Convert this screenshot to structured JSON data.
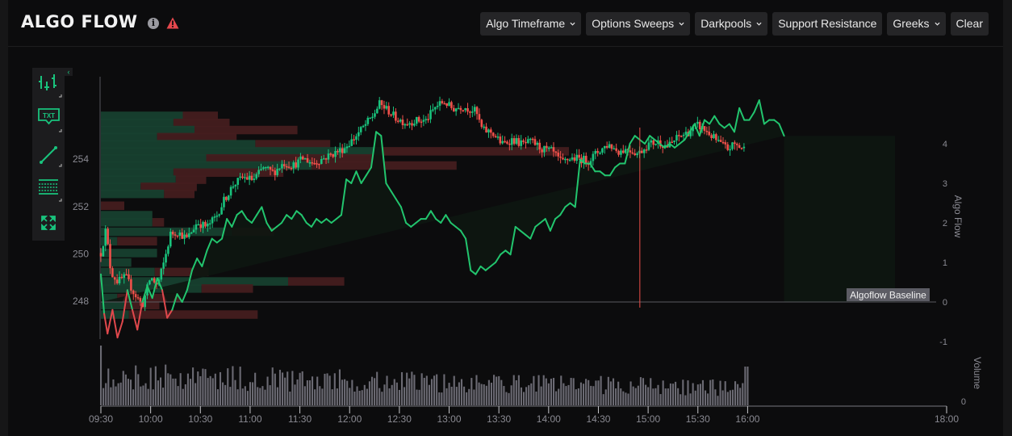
{
  "header": {
    "title": "ALGO FLOW",
    "info_icon": "info-icon",
    "warning_icon": "warning-triangle-icon",
    "warning_color": "#e5484d"
  },
  "toolbar": {
    "buttons": [
      {
        "label": "Algo Timeframe",
        "dropdown": true
      },
      {
        "label": "Options Sweeps",
        "dropdown": true
      },
      {
        "label": "Darkpools",
        "dropdown": true
      },
      {
        "label": "Support Resistance",
        "dropdown": false
      },
      {
        "label": "Greeks",
        "dropdown": true
      },
      {
        "label": "Clear",
        "dropdown": false
      }
    ]
  },
  "drawing_tools": [
    {
      "name": "candlestick-tool",
      "icon": "candles-icon"
    },
    {
      "name": "text-tool",
      "icon": "txt-icon",
      "label": "TXT"
    },
    {
      "name": "trendline-tool",
      "icon": "line-icon"
    },
    {
      "name": "levels-tool",
      "icon": "grid-lines-icon"
    },
    {
      "name": "fullscreen-tool",
      "icon": "expand-icon"
    }
  ],
  "colors": {
    "up": "#19c37d",
    "down": "#f0504a",
    "profile_buy": "#17402f",
    "profile_sell": "#441d1f",
    "algo_line_pos": "#22c56e",
    "algo_line_neg": "#e0484c",
    "algo_fill": "#0d1611",
    "volume": "#6b6a73",
    "axis_text": "#8a8a92",
    "accent": "#19c37d"
  },
  "chart_data": {
    "type": "candlestick+line+volume",
    "title": "ALGO FLOW",
    "x_ticks": [
      "09:30",
      "10:00",
      "10:30",
      "11:00",
      "11:30",
      "12:00",
      "12:30",
      "13:00",
      "13:30",
      "14:00",
      "14:30",
      "15:00",
      "15:30",
      "16:00",
      "18:00"
    ],
    "x_range_minutes": [
      570,
      1080
    ],
    "price_axis": {
      "ticks": [
        248,
        250,
        252,
        254
      ],
      "range": [
        246.5,
        256.5
      ]
    },
    "algo_axis": {
      "label": "Algo Flow",
      "ticks": [
        -1,
        0,
        1,
        2,
        3,
        4
      ],
      "range": [
        -1.2,
        5.3
      ]
    },
    "volume_axis": {
      "label": "Volume",
      "ticks": [
        0
      ]
    },
    "baseline_label": "Algoflow Baseline",
    "marker_time": "14:55",
    "price_path": [
      [
        570,
        250.0
      ],
      [
        573,
        251.0
      ],
      [
        576,
        249.2
      ],
      [
        580,
        248.8
      ],
      [
        585,
        249.0
      ],
      [
        590,
        248.3
      ],
      [
        595,
        247.8
      ],
      [
        600,
        249.0
      ],
      [
        604,
        248.6
      ],
      [
        608,
        249.6
      ],
      [
        612,
        250.8
      ],
      [
        616,
        250.9
      ],
      [
        622,
        250.6
      ],
      [
        628,
        251.3
      ],
      [
        634,
        251.1
      ],
      [
        640,
        251.6
      ],
      [
        644,
        252.2
      ],
      [
        650,
        252.9
      ],
      [
        656,
        253.2
      ],
      [
        662,
        253.1
      ],
      [
        668,
        253.6
      ],
      [
        674,
        253.4
      ],
      [
        680,
        253.8
      ],
      [
        686,
        253.7
      ],
      [
        692,
        254.0
      ],
      [
        698,
        253.8
      ],
      [
        704,
        254.0
      ],
      [
        710,
        254.2
      ],
      [
        716,
        254.4
      ],
      [
        722,
        254.8
      ],
      [
        728,
        255.3
      ],
      [
        734,
        255.8
      ],
      [
        738,
        256.3
      ],
      [
        742,
        256.1
      ],
      [
        748,
        255.7
      ],
      [
        754,
        255.5
      ],
      [
        760,
        255.6
      ],
      [
        766,
        255.6
      ],
      [
        772,
        256.2
      ],
      [
        777,
        256.4
      ],
      [
        782,
        256.1
      ],
      [
        788,
        256.2
      ],
      [
        796,
        256.0
      ],
      [
        800,
        255.2
      ],
      [
        806,
        255.1
      ],
      [
        812,
        254.6
      ],
      [
        818,
        254.8
      ],
      [
        824,
        254.6
      ],
      [
        830,
        254.7
      ],
      [
        836,
        254.4
      ],
      [
        842,
        254.3
      ],
      [
        848,
        253.8
      ],
      [
        852,
        254.0
      ],
      [
        858,
        254.0
      ],
      [
        864,
        253.9
      ],
      [
        870,
        254.3
      ],
      [
        876,
        254.6
      ],
      [
        882,
        254.3
      ],
      [
        888,
        254.4
      ],
      [
        894,
        254.2
      ],
      [
        900,
        254.6
      ],
      [
        906,
        254.7
      ],
      [
        912,
        254.5
      ],
      [
        918,
        254.9
      ],
      [
        924,
        255.1
      ],
      [
        930,
        255.4
      ],
      [
        936,
        255.1
      ],
      [
        942,
        254.7
      ],
      [
        948,
        254.4
      ],
      [
        952,
        254.6
      ],
      [
        958,
        254.4
      ],
      [
        964,
        254.7
      ],
      [
        970,
        254.5
      ],
      [
        976,
        254.4
      ],
      [
        980,
        254.5
      ],
      [
        986,
        254.9
      ],
      [
        992,
        254.6
      ],
      [
        998,
        254.5
      ],
      [
        1004,
        254.4
      ],
      [
        1010,
        254.2
      ],
      [
        1016,
        254.0
      ],
      [
        1020,
        254.1
      ],
      [
        1024,
        254.2
      ],
      [
        1026,
        254.6
      ],
      [
        1030,
        254.4
      ],
      [
        1032,
        254.5
      ]
    ],
    "algo_flow_path": [
      [
        570,
        0.7
      ],
      [
        572,
        -0.3
      ],
      [
        574,
        -0.8
      ],
      [
        577,
        -0.2
      ],
      [
        580,
        -0.9
      ],
      [
        583,
        -0.5
      ],
      [
        586,
        0.3
      ],
      [
        589,
        -0.2
      ],
      [
        592,
        -0.7
      ],
      [
        595,
        0.0
      ],
      [
        598,
        0.4
      ],
      [
        601,
        0.1
      ],
      [
        604,
        0.6
      ],
      [
        607,
        0.3
      ],
      [
        610,
        -0.4
      ],
      [
        613,
        -0.2
      ],
      [
        616,
        0.2
      ],
      [
        619,
        0.0
      ],
      [
        622,
        0.3
      ],
      [
        625,
        0.8
      ],
      [
        628,
        1.1
      ],
      [
        631,
        0.9
      ],
      [
        634,
        1.3
      ],
      [
        637,
        1.6
      ],
      [
        640,
        1.5
      ],
      [
        643,
        1.6
      ],
      [
        646,
        2.1
      ],
      [
        649,
        1.9
      ],
      [
        652,
        2.2
      ],
      [
        655,
        2.3
      ],
      [
        658,
        2.1
      ],
      [
        661,
        2.0
      ],
      [
        664,
        2.2
      ],
      [
        667,
        2.4
      ],
      [
        670,
        2.0
      ],
      [
        673,
        1.8
      ],
      [
        676,
        1.9
      ],
      [
        679,
        2.0
      ],
      [
        682,
        2.2
      ],
      [
        685,
        2.1
      ],
      [
        688,
        2.3
      ],
      [
        691,
        2.2
      ],
      [
        694,
        2.0
      ],
      [
        697,
        1.9
      ],
      [
        700,
        2.1
      ],
      [
        703,
        2.0
      ],
      [
        706,
        2.1
      ],
      [
        709,
        2.0
      ],
      [
        712,
        2.1
      ],
      [
        715,
        2.2
      ],
      [
        718,
        3.1
      ],
      [
        721,
        3.0
      ],
      [
        724,
        3.3
      ],
      [
        727,
        3.0
      ],
      [
        730,
        3.2
      ],
      [
        733,
        3.4
      ],
      [
        736,
        4.3
      ],
      [
        739,
        4.2
      ],
      [
        742,
        3.0
      ],
      [
        745,
        2.8
      ],
      [
        748,
        2.6
      ],
      [
        751,
        2.4
      ],
      [
        754,
        2.0
      ],
      [
        757,
        1.9
      ],
      [
        760,
        2.0
      ],
      [
        763,
        2.1
      ],
      [
        766,
        2.1
      ],
      [
        769,
        2.3
      ],
      [
        772,
        2.1
      ],
      [
        775,
        2.0
      ],
      [
        778,
        2.2
      ],
      [
        781,
        2.0
      ],
      [
        784,
        1.9
      ],
      [
        787,
        1.8
      ],
      [
        790,
        1.6
      ],
      [
        793,
        0.8
      ],
      [
        796,
        0.7
      ],
      [
        799,
        0.9
      ],
      [
        802,
        0.8
      ],
      [
        805,
        0.9
      ],
      [
        808,
        1.0
      ],
      [
        811,
        1.2
      ],
      [
        814,
        1.3
      ],
      [
        817,
        1.2
      ],
      [
        820,
        1.9
      ],
      [
        823,
        1.8
      ],
      [
        826,
        1.7
      ],
      [
        829,
        1.6
      ],
      [
        832,
        1.9
      ],
      [
        835,
        2.0
      ],
      [
        838,
        2.1
      ],
      [
        841,
        1.8
      ],
      [
        844,
        2.1
      ],
      [
        847,
        2.2
      ],
      [
        850,
        2.4
      ],
      [
        853,
        2.5
      ],
      [
        856,
        2.4
      ],
      [
        859,
        3.6
      ],
      [
        862,
        3.5
      ],
      [
        865,
        3.5
      ],
      [
        868,
        3.3
      ],
      [
        871,
        3.3
      ],
      [
        874,
        3.2
      ],
      [
        877,
        3.2
      ],
      [
        880,
        3.4
      ],
      [
        883,
        3.5
      ],
      [
        886,
        3.5
      ],
      [
        889,
        4.0
      ],
      [
        892,
        4.2
      ],
      [
        895,
        4.1
      ],
      [
        898,
        4.0
      ],
      [
        901,
        4.2
      ],
      [
        904,
        4.1
      ],
      [
        907,
        4.0
      ],
      [
        910,
        3.9
      ],
      [
        913,
        4.0
      ],
      [
        916,
        3.9
      ],
      [
        919,
        4.0
      ],
      [
        922,
        4.1
      ],
      [
        925,
        4.3
      ],
      [
        928,
        4.5
      ],
      [
        931,
        4.2
      ],
      [
        934,
        4.6
      ],
      [
        937,
        4.5
      ],
      [
        940,
        4.7
      ],
      [
        943,
        4.5
      ],
      [
        946,
        4.4
      ],
      [
        949,
        4.5
      ],
      [
        952,
        4.3
      ],
      [
        955,
        4.9
      ],
      [
        958,
        4.6
      ],
      [
        961,
        4.6
      ],
      [
        964,
        4.8
      ],
      [
        967,
        5.1
      ],
      [
        970,
        4.5
      ],
      [
        973,
        4.6
      ],
      [
        976,
        4.6
      ],
      [
        979,
        4.5
      ],
      [
        982,
        4.2
      ]
    ],
    "volume_profile": [
      {
        "price": 255.8,
        "buy": 0.35,
        "sell": 0.15
      },
      {
        "price": 255.5,
        "buy": 0.31,
        "sell": 0.24
      },
      {
        "price": 255.2,
        "buy": 0.4,
        "sell": 0.44
      },
      {
        "price": 254.9,
        "buy": 0.24,
        "sell": 0.34
      },
      {
        "price": 254.6,
        "buy": 0.66,
        "sell": 0.32
      },
      {
        "price": 254.3,
        "buy": 1.2,
        "sell": 0.8
      },
      {
        "price": 254.0,
        "buy": 0.45,
        "sell": 0.76
      },
      {
        "price": 253.7,
        "buy": 0.9,
        "sell": 0.62
      },
      {
        "price": 253.4,
        "buy": 0.31,
        "sell": 0.47
      },
      {
        "price": 253.1,
        "buy": 0.32,
        "sell": 0.13
      },
      {
        "price": 252.8,
        "buy": 0.17,
        "sell": 0.24
      },
      {
        "price": 252.5,
        "buy": 0.27,
        "sell": 0.13
      },
      {
        "price": 252.0,
        "buy": 0.0,
        "sell": 0.1
      },
      {
        "price": 251.6,
        "buy": 0.22,
        "sell": 0.0
      },
      {
        "price": 251.3,
        "buy": 0.22,
        "sell": 0.05
      },
      {
        "price": 250.9,
        "buy": 0.56,
        "sell": 0.18
      },
      {
        "price": 250.5,
        "buy": 0.07,
        "sell": 0.17
      },
      {
        "price": 250.0,
        "buy": 0.24,
        "sell": 0.0
      },
      {
        "price": 249.6,
        "buy": 0.13,
        "sell": 0.0
      },
      {
        "price": 249.2,
        "buy": 0.23,
        "sell": 0.23
      },
      {
        "price": 248.8,
        "buy": 0.8,
        "sell": 0.24
      },
      {
        "price": 248.5,
        "buy": 0.43,
        "sell": 0.22
      },
      {
        "price": 248.1,
        "buy": 0.07,
        "sell": 0.28
      },
      {
        "price": 247.8,
        "buy": 0.1,
        "sell": 0.15
      },
      {
        "price": 247.4,
        "buy": 0.12,
        "sell": 0.55
      }
    ],
    "volume_seed": 7,
    "volume_scale_note": "relative bar heights, open spike at 09:30 and close spike at 16:00"
  }
}
